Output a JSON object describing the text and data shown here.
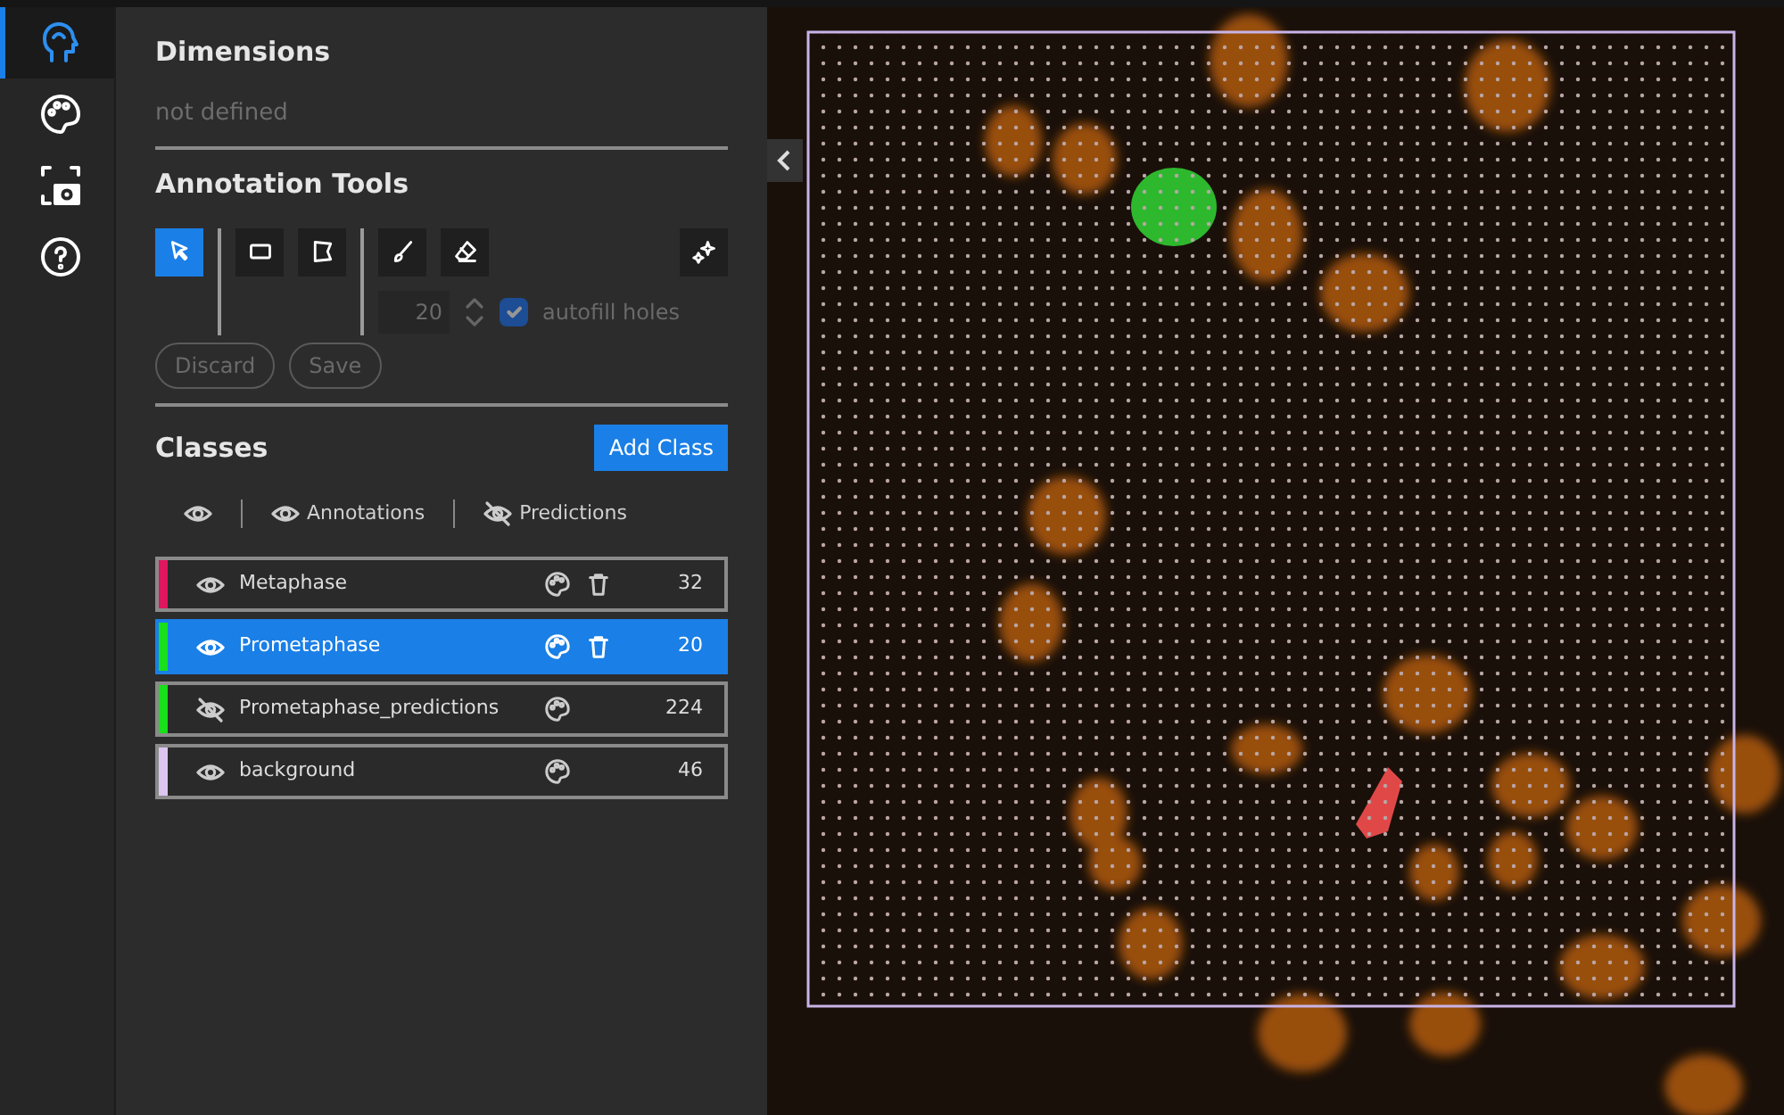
{
  "nav": [
    {
      "kind": "head",
      "selected": true
    },
    {
      "kind": "palette",
      "selected": false
    },
    {
      "kind": "camera",
      "selected": false
    },
    {
      "kind": "help",
      "selected": false
    }
  ],
  "dimensions": {
    "title": "Dimensions",
    "value": "not defined"
  },
  "annotation_tools": {
    "title": "Annotation Tools",
    "tool_groups": [
      {
        "tools": [
          {
            "kind": "pointer",
            "selected": true
          }
        ]
      },
      {
        "tools": [
          {
            "kind": "rectangle",
            "selected": false
          },
          {
            "kind": "polygon",
            "selected": false
          }
        ]
      },
      {
        "tools": [
          {
            "kind": "brush",
            "selected": false
          },
          {
            "kind": "eraser",
            "selected": false
          }
        ]
      },
      {
        "tools": [
          {
            "kind": "sparkle",
            "selected": false
          }
        ]
      }
    ],
    "brush_size": {
      "value": "20",
      "disabled": true
    },
    "autofill": {
      "label": "autofill holes",
      "checked": true,
      "disabled": true
    },
    "buttons": [
      {
        "label": "Discard",
        "disabled": true
      },
      {
        "label": "Save",
        "disabled": true
      }
    ]
  },
  "classes": {
    "title": "Classes",
    "add_button": "Add Class",
    "toggles": [
      {
        "visible": true
      },
      {
        "label": "Annotations",
        "visible": true
      },
      {
        "label": "Predictions",
        "visible": false
      }
    ],
    "items": [
      {
        "name": "Metaphase",
        "color": "#e0165e",
        "visible": true,
        "deletable": true,
        "count": "32",
        "selected": false
      },
      {
        "name": "Prometaphase",
        "color": "#18e01a",
        "visible": true,
        "deletable": true,
        "count": "20",
        "selected": true
      },
      {
        "name": "Prometaphase_predictions",
        "color": "#18e01a",
        "visible": false,
        "deletable": false,
        "count": "224",
        "selected": false
      },
      {
        "name": "background",
        "color": "#dcc6f0",
        "visible": true,
        "deletable": false,
        "count": "46",
        "selected": false
      }
    ]
  }
}
